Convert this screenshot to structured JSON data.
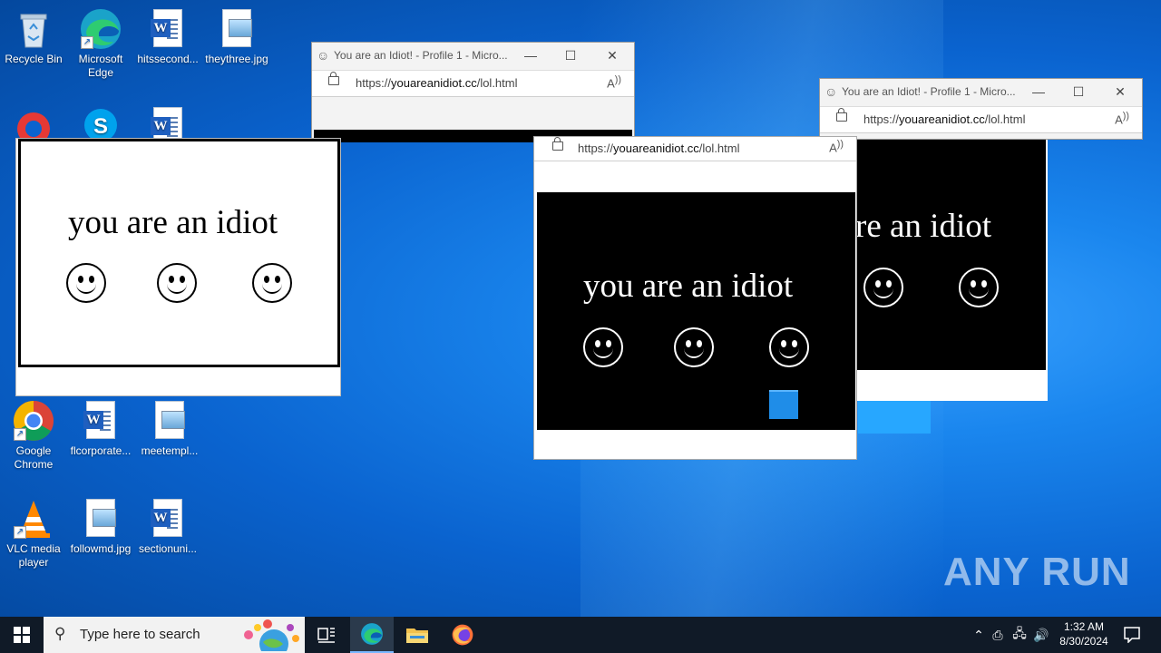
{
  "desktop_icons": [
    {
      "label": "Recycle Bin",
      "icon": "recycle-bin-icon"
    },
    {
      "label": "Microsoft Edge",
      "icon": "edge-icon"
    },
    {
      "label": "hitssecond...",
      "icon": "word-doc-icon"
    },
    {
      "label": "theythree.jpg",
      "icon": "image-file-icon"
    },
    {
      "label": "Google Chrome",
      "icon": "chrome-icon"
    },
    {
      "label": "flcorporate...",
      "icon": "word-doc-icon"
    },
    {
      "label": "meetempl...",
      "icon": "image-file-icon"
    },
    {
      "label": "VLC media player",
      "icon": "vlc-icon"
    },
    {
      "label": "followmd.jpg",
      "icon": "image-file-icon"
    },
    {
      "label": "sectionuni...",
      "icon": "word-doc-icon"
    }
  ],
  "browser_windows": [
    {
      "title": "You are an Idiot! - Profile 1 - Micro...",
      "url_prefix": "https://",
      "url_host": "youareanidiot.cc",
      "url_path": "/lol.html"
    },
    {
      "title": "You are an Idiot! - Profile 1 - Micro...",
      "url_prefix": "https://",
      "url_host": "youareanidiot.cc",
      "url_path": "/lol.html"
    }
  ],
  "popups": [
    {
      "url_prefix": "https://",
      "url_host": "youareanidiot.cc",
      "url_path": "/lol.html",
      "text": "you are an idiot",
      "theme": "dark"
    },
    {
      "text": "re an idiot",
      "theme": "dark"
    },
    {
      "text": "you are an idiot",
      "theme": "light"
    }
  ],
  "taskbar": {
    "search_placeholder": "Type here to search",
    "time": "1:32 AM",
    "date": "8/30/2024"
  },
  "watermark": "ANY RUN",
  "colors": {
    "taskbar": "#101a27",
    "desktop_blue": "#0a63cf"
  }
}
